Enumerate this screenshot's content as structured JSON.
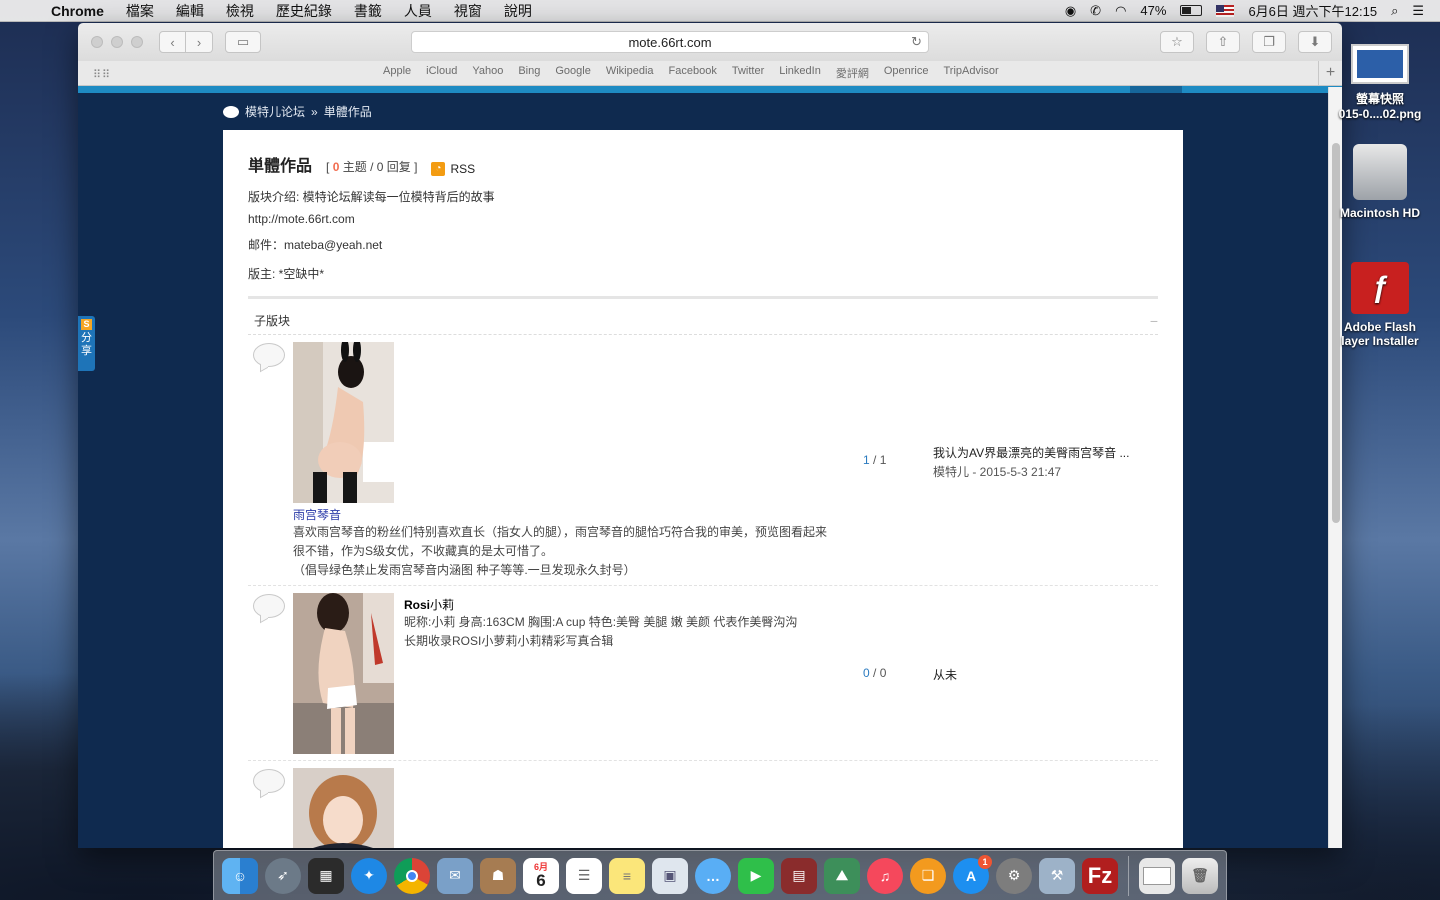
{
  "menubar": {
    "app_name": "Chrome",
    "items": [
      "檔案",
      "編輯",
      "檢視",
      "歷史紀錄",
      "書籤",
      "人員",
      "視窗",
      "說明"
    ],
    "battery": "47%",
    "datetime": "6月6日 週六下午12:15"
  },
  "browser": {
    "url": "mote.66rt.com",
    "bookmarks": [
      "Apple",
      "iCloud",
      "Yahoo",
      "Bing",
      "Google",
      "Wikipedia",
      "Facebook",
      "Twitter",
      "LinkedIn",
      "愛評網",
      "Openrice",
      "TripAdvisor"
    ]
  },
  "page": {
    "breadcrumb": {
      "root": "模特儿论坛",
      "sep": "»",
      "current": "単體作品"
    },
    "share_tab": "分享",
    "forum": {
      "title": "単體作品",
      "stats_prefix": "[",
      "topics": "0",
      "stats_text": "主题 / 0 回复",
      "stats_suffix": "]",
      "rss": "RSS",
      "intro": "版块介绍: 模特论坛解读每一位模特背后的故事",
      "url": "http://mote.66rt.com",
      "email": "邮件：mateba@yeah.net",
      "moderator": "版主: *空缺中*"
    },
    "subforum_header": "子版块",
    "subforums": [
      {
        "name": "雨宫琴音",
        "desc_1": "喜欢雨宫琴音的粉丝们特别喜欢直长（指女人的腿），雨宫琴音的腿恰巧符合我的审美，预览图看起来",
        "desc_2": "很不错，作为S级女优，不收藏真的是太可惜了。",
        "desc_3": "（倡导绿色禁止发雨宫琴音内涵图 种子等等.一旦发现永久封号）",
        "stats_a": "1",
        "stats_sep": "/",
        "stats_b": "1",
        "latest_title": "我认为AV界最漂亮的美臀雨宫琴音 ...",
        "latest_meta": "模特儿 - 2015-5-3 21:47"
      },
      {
        "name_bold": "Rosi",
        "name_rest": "小莉",
        "desc_1": "昵称:小莉 身高:163CM 胸围:A cup 特色:美臀 美腿 嫩 美颜 代表作美臀沟沟",
        "desc_2": "长期收录ROSI小萝莉小莉精彩写真合辑",
        "stats_a": "0",
        "stats_sep": "/",
        "stats_b": "0",
        "latest_title": "从未"
      }
    ]
  },
  "desktop": {
    "icons": [
      {
        "label_1": "螢幕快照",
        "label_2": "015-0....02.png"
      },
      {
        "label_1": "Macintosh HD"
      },
      {
        "label_1": "Adobe Flash",
        "label_2": "layer Installer"
      }
    ]
  },
  "dock": {
    "calendar_day": "6",
    "calendar_month": "6月",
    "appstore_badge": "1"
  },
  "colors": {
    "accent_blue": "#1e8bc3",
    "page_bg": "#0f2a4f",
    "topic_count": "#f26c4f",
    "link_blue": "#2b7bc0"
  }
}
